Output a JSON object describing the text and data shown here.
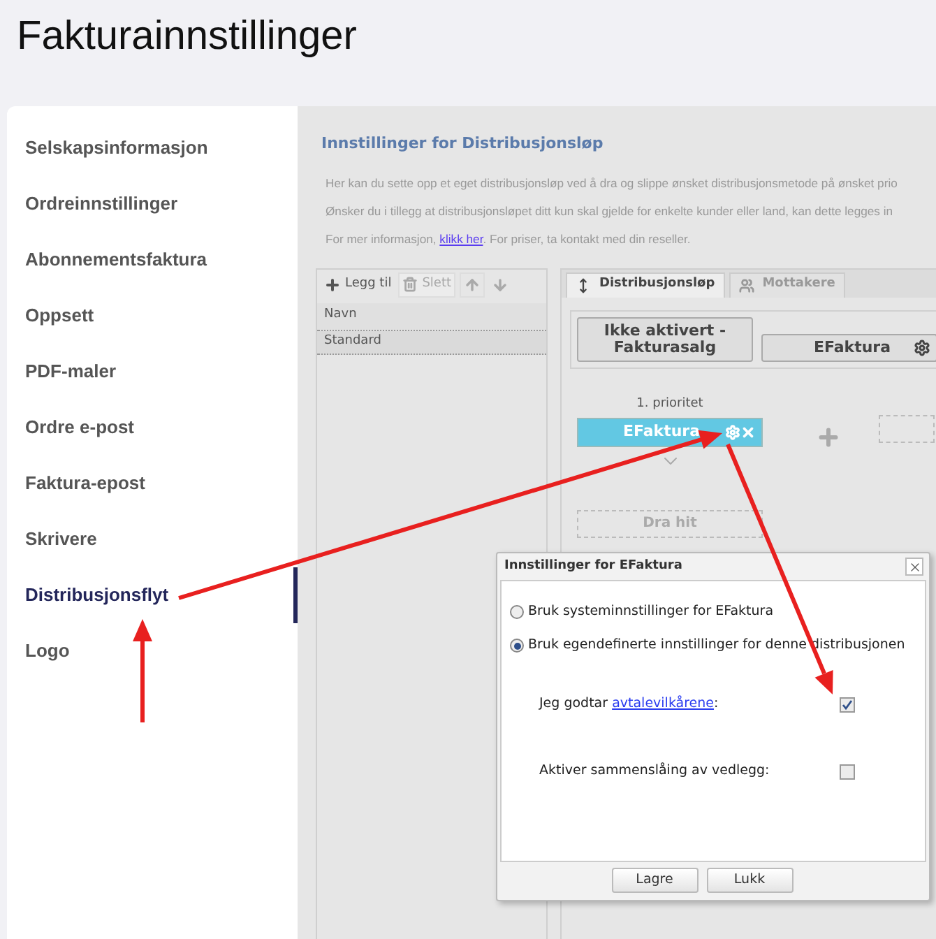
{
  "page_title": "Fakturainnstillinger",
  "sidebar": {
    "items": [
      {
        "label": "Selskapsinformasjon",
        "selected": false
      },
      {
        "label": "Ordreinnstillinger",
        "selected": false
      },
      {
        "label": "Abonnementsfaktura",
        "selected": false
      },
      {
        "label": "Oppsett",
        "selected": false
      },
      {
        "label": "PDF-maler",
        "selected": false
      },
      {
        "label": "Ordre e-post",
        "selected": false
      },
      {
        "label": "Faktura-epost",
        "selected": false
      },
      {
        "label": "Skrivere",
        "selected": false
      },
      {
        "label": "Distribusjonsflyt",
        "selected": true
      },
      {
        "label": "Logo",
        "selected": false
      }
    ]
  },
  "section": {
    "title": "Innstillinger for Distribusjonsløp",
    "intro": [
      "Her kan du sette opp et eget distribusjonsløp ved å dra og slippe ønsket distribusjonsmetode på ønsket prio",
      "Ønsker du i tillegg at distribusjonsløpet ditt kun skal gjelde for enkelte kunder eller land, kan dette legges in"
    ],
    "info": {
      "prefix": "For mer informasjon,",
      "link": "klikk her",
      "suffix": ". For priser, ta kontakt med din reseller."
    }
  },
  "list_panel": {
    "toolbar": [
      {
        "kind": "add",
        "label": "Legg til",
        "disabled": false
      },
      {
        "kind": "delete",
        "label": "Slett",
        "disabled": true
      }
    ],
    "column": "Navn",
    "rows": [
      {
        "name": "Standard",
        "selected": true
      }
    ]
  },
  "flow_panel": {
    "tabs": [
      {
        "kind": "order",
        "label": "Distribusjonsløp",
        "selected": true
      },
      {
        "kind": "people",
        "label": "Mottakere",
        "selected": false
      }
    ],
    "methods": [
      {
        "label": "Ikke aktivert - Fakturasalg",
        "settings": false
      },
      {
        "label": "EFaktura",
        "settings": true
      }
    ],
    "priorities": [
      {
        "label": "1. prioritet",
        "method": "EFaktura"
      }
    ],
    "drop_zone": "Dra hit"
  },
  "dialog": {
    "title": "Innstillinger for EFaktura",
    "options": [
      {
        "label": "Bruk systeminnstillinger for EFaktura",
        "selected": false
      },
      {
        "label": "Bruk egendefinerte innstillinger for denne distribusjonen",
        "selected": true
      }
    ],
    "settings": [
      {
        "label": "Jeg godtar",
        "link": "avtalevilkårene",
        "suffix": ":",
        "checked": true
      },
      {
        "label": "Aktiver sammenslåing av vedlegg:",
        "checked": false
      }
    ],
    "buttons": [
      "Lagre",
      "Lukk"
    ]
  }
}
